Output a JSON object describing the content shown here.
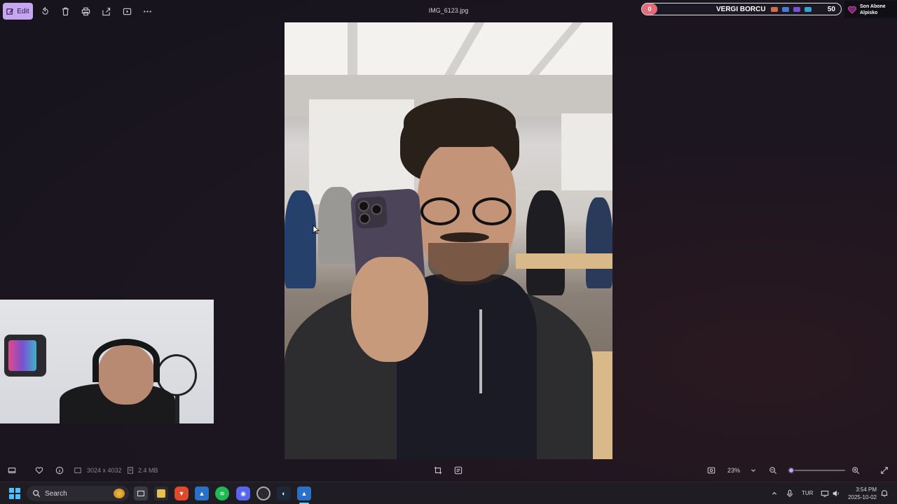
{
  "toolbar": {
    "edit_label": "Edit",
    "file_title": "IMG_6123.jpg"
  },
  "overlay": {
    "counter_left": "0",
    "title": "VERGI BORCU",
    "counter_right": "50",
    "sub_line1": "Son Abone",
    "sub_line2": "Alpisko"
  },
  "status": {
    "dimensions": "3024 x 4032",
    "file_size": "2.4 MB",
    "zoom": "23%",
    "zoom_fraction": 0.04
  },
  "taskbar": {
    "search_placeholder": "Search",
    "language": "TUR",
    "time": "3:54 PM",
    "date": "2025-10-02"
  },
  "colors": {
    "accent": "#c6a6f0",
    "background": "#1a1520",
    "overlay_red": "#e56b7a"
  }
}
